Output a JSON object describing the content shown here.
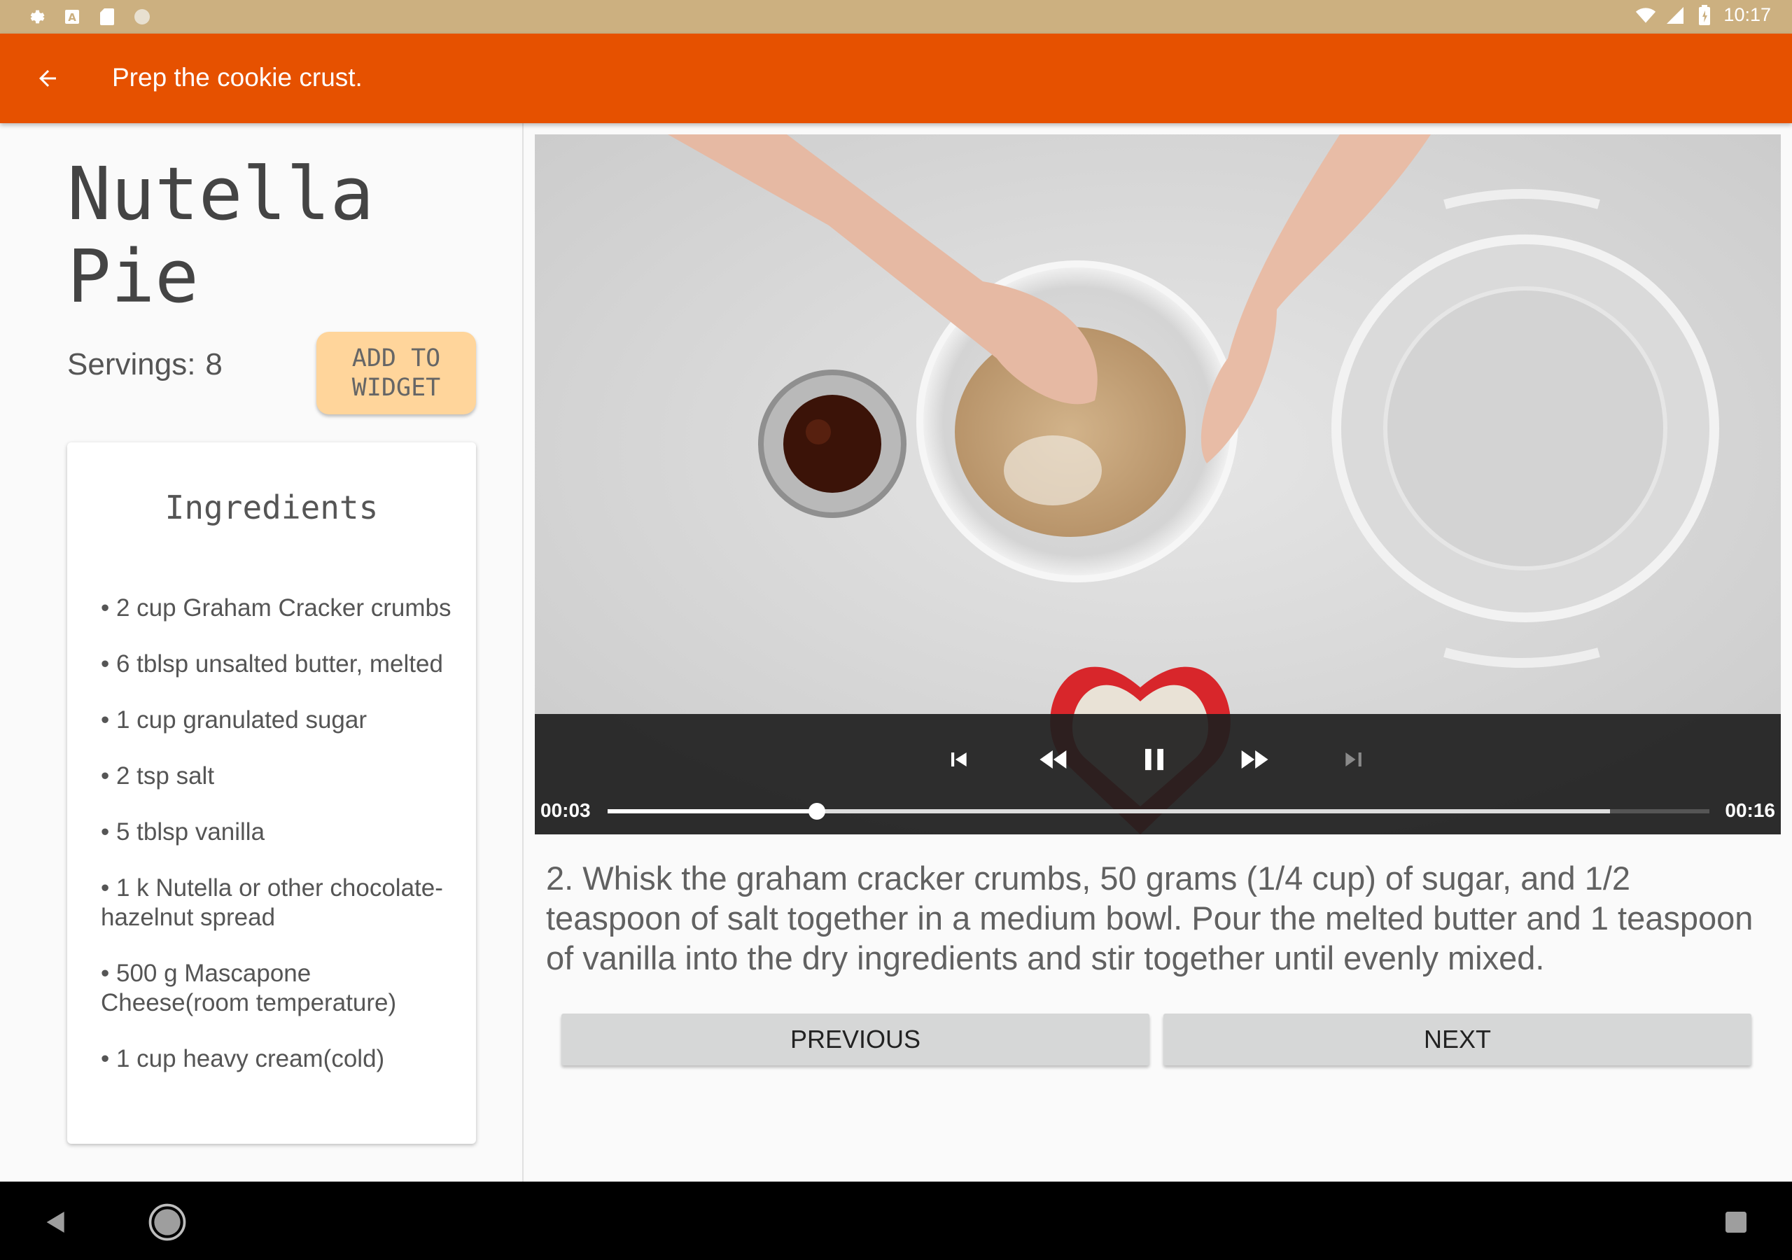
{
  "status_bar": {
    "time": "10:17",
    "left_icons": [
      "gear-icon",
      "font-a-icon",
      "sd-card-icon",
      "circle-icon"
    ],
    "right_icons": [
      "wifi-icon",
      "signal-icon",
      "battery-icon"
    ]
  },
  "app_bar": {
    "back_icon": "arrow-left-icon",
    "title": "Prep the cookie crust.",
    "color": "#e65100"
  },
  "recipe": {
    "name": "Nutella Pie",
    "servings_label": "Servings:",
    "servings_value": "8",
    "add_widget_label": "ADD TO WIDGET"
  },
  "ingredients": {
    "heading": "Ingredients",
    "items": [
      "• 2 cup Graham Cracker crumbs",
      "• 6 tblsp unsalted butter, melted",
      "• 1 cup granulated sugar",
      "• 2 tsp salt",
      "• 5 tblsp vanilla",
      "• 1 k Nutella or other chocolate-hazelnut spread",
      "• 500 g Mascapone Cheese(room temperature)",
      "• 1 cup heavy cream(cold)"
    ]
  },
  "player": {
    "current_time": "00:03",
    "duration": "00:16",
    "progress_fraction": 0.19,
    "buffered_fraction": 0.91,
    "controls": [
      "skip-previous-icon",
      "rewind-icon",
      "pause-icon",
      "fast-forward-icon",
      "skip-next-icon"
    ],
    "skip_next_enabled": false
  },
  "step": {
    "description": "2. Whisk the graham cracker crumbs, 50 grams (1/4 cup) of sugar, and 1/2 teaspoon of salt together in a medium bowl. Pour the melted butter and 1 teaspoon of vanilla into the dry ingredients and stir together until evenly mixed."
  },
  "navigation": {
    "previous_label": "PREVIOUS",
    "next_label": "NEXT"
  },
  "system_nav": {
    "buttons": [
      "back-triangle-icon",
      "home-circle-icon",
      "recents-square-icon"
    ]
  }
}
